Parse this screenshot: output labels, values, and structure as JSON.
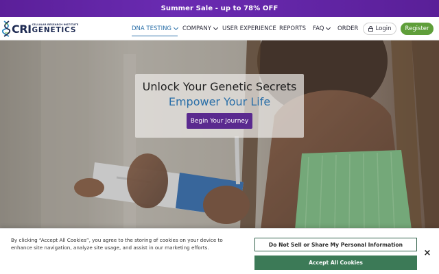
{
  "promo": {
    "text": "Summer Sale - up to 78% OFF",
    "background": "#5b1f99"
  },
  "logo": {
    "brand": "CRI",
    "tagline": "CELLULAR RESEARCH INSTITUTE",
    "wordmark": "GENETICS",
    "icon": "dna-helix-icon"
  },
  "nav": {
    "items": [
      {
        "label": "DNA TESTING",
        "dropdown": true,
        "active": true
      },
      {
        "label": "COMPANY",
        "dropdown": true,
        "active": false
      },
      {
        "label": "USER EXPERIENCE",
        "dropdown": false,
        "active": false
      },
      {
        "label": "REPORTS",
        "dropdown": false,
        "active": false
      },
      {
        "label": "FAQ",
        "dropdown": true,
        "active": false
      },
      {
        "label": "ORDER",
        "dropdown": false,
        "active": false
      }
    ],
    "login_label": "Login",
    "register_label": "Register",
    "accent": "#2a6fa8",
    "register_color": "#5f9e3a"
  },
  "hero": {
    "title": "Unlock Your Genetic Secrets",
    "subtitle": "Empower Your Life",
    "cta_label": "Begin Your Journey",
    "cta_color": "#5a2a8f"
  },
  "cookie": {
    "text": "By clicking “Accept All Cookies”, you agree to the storing of cookies on your device to enhance site navigation, analyze site usage, and assist in our marketing efforts.",
    "do_not_sell_label": "Do Not Sell or Share My Personal Information",
    "accept_label": "Accept All Cookies",
    "close_label": "×",
    "accept_color": "#3c7a57"
  }
}
